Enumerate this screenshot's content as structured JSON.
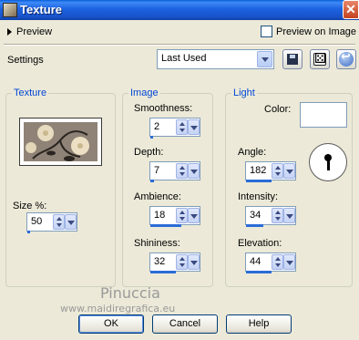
{
  "window": {
    "title": "Texture"
  },
  "preview": {
    "label": "Preview",
    "checkbox_label": "Preview on Image",
    "checked": false
  },
  "settings": {
    "label": "Settings",
    "value": "Last Used"
  },
  "texture_group": {
    "title": "Texture",
    "size_label": "Size %:",
    "size_value": "50",
    "size_fraction": 0.02
  },
  "image_group": {
    "title": "Image",
    "smoothness_label": "Smoothness:",
    "smoothness_value": "2",
    "smoothness_fraction": 0.02,
    "depth_label": "Depth:",
    "depth_value": "7",
    "depth_fraction": 0.07,
    "ambience_label": "Ambience:",
    "ambience_value": "18",
    "ambience_fraction": 0.6,
    "shininess_label": "Shininess:",
    "shininess_value": "32",
    "shininess_fraction": 0.5
  },
  "light_group": {
    "title": "Light",
    "color_label": "Color:",
    "color_value": "#ffffff",
    "angle_label": "Angle:",
    "angle_value": "182",
    "angle_fraction": 0.5,
    "intensity_label": "Intensity:",
    "intensity_value": "34",
    "intensity_fraction": 0.34,
    "elevation_label": "Elevation:",
    "elevation_value": "44",
    "elevation_fraction": 0.5
  },
  "watermark": {
    "line1": "Pinuccia",
    "line2": "www.maidiregrafica.eu"
  },
  "buttons": {
    "ok": "OK",
    "cancel": "Cancel",
    "help": "Help"
  },
  "colors": {
    "title_bar": "#1852c8",
    "group_title": "#0046d5",
    "slider_fill": "#2a6cd8"
  }
}
